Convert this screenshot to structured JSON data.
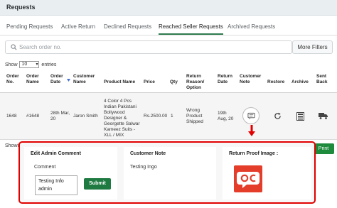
{
  "page": {
    "title": "Requests"
  },
  "tabs": [
    {
      "label": "Pending Requests"
    },
    {
      "label": "Active Return"
    },
    {
      "label": "Declined Requests"
    },
    {
      "label": "Reached Seller Requests",
      "active": true
    },
    {
      "label": "Archived Requests"
    }
  ],
  "search": {
    "placeholder": "Search order no.",
    "more_filters": "More Filters"
  },
  "entries": {
    "show": "Show",
    "value": "10",
    "suffix": "entries"
  },
  "table": {
    "headers": {
      "order_no": [
        "Order",
        "No."
      ],
      "order_name": [
        "Order",
        "Name"
      ],
      "order_date": [
        "Order",
        "Date"
      ],
      "customer_name": [
        "Customer",
        "Name"
      ],
      "product_name": "Product Name",
      "price": "Price",
      "qty": "Qty",
      "return_reason": [
        "Return",
        "Reason/",
        "Option"
      ],
      "return_date": [
        "Return",
        "Date"
      ],
      "customer_note": [
        "Customer",
        "Note"
      ],
      "restore": "Restore",
      "archive": "Archive",
      "sent_back": [
        "Sent",
        "Back"
      ]
    },
    "row": {
      "order_no": "1648",
      "order_name": "#1648",
      "order_date": [
        "28th Mar,",
        "20"
      ],
      "customer_name": "Jaron Smith",
      "product_name": [
        "4 Color 4 Pcs",
        "Indian Pakistani",
        "Bollywood",
        "Designer &",
        "Georgette Salwar",
        "Kameez Suits -",
        "XLL / MIX"
      ],
      "price": "Rs.2500.00",
      "qty": "1",
      "return_reason": [
        "Wrong",
        "Product",
        "Shipped"
      ],
      "return_date": [
        "19th",
        "Aug, 20"
      ]
    }
  },
  "footer": {
    "show_partial": "Showi",
    "print": "Print"
  },
  "detail_panel": {
    "edit_comment": {
      "title": "Edit Admin Comment",
      "label": "Comment",
      "value_lines": [
        "Testing Info",
        "admin"
      ],
      "submit": "Submit"
    },
    "customer_note": {
      "title": "Customer Note",
      "value": "Testing Ingo"
    },
    "return_proof": {
      "title": "Return Proof Image :"
    }
  },
  "colors": {
    "accent": "#1e7a41",
    "highlight": "#e10000",
    "logo": "#e43e2b"
  }
}
